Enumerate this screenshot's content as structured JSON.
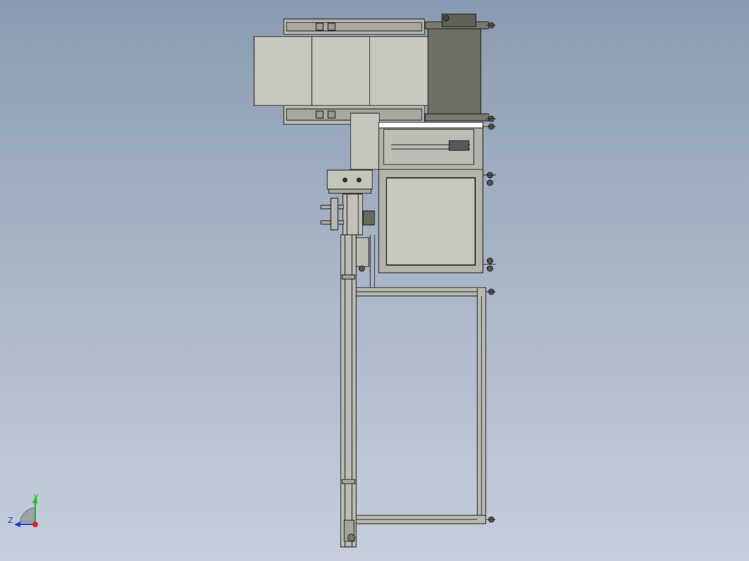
{
  "viewport": {
    "background_top": "#8a9bb1",
    "background_bottom": "#c6cfdb"
  },
  "colors": {
    "panel": "#c9c8be",
    "panel_dark": "#6f7163",
    "frame": "#b8b8b0",
    "line": "#1e1e1e",
    "white_rail": "#ffffff"
  },
  "triad": {
    "y_label": "Y",
    "z_label": "Z",
    "y_color": "#19c219",
    "z_color": "#2233dd",
    "x_color": "#e01f1f"
  }
}
